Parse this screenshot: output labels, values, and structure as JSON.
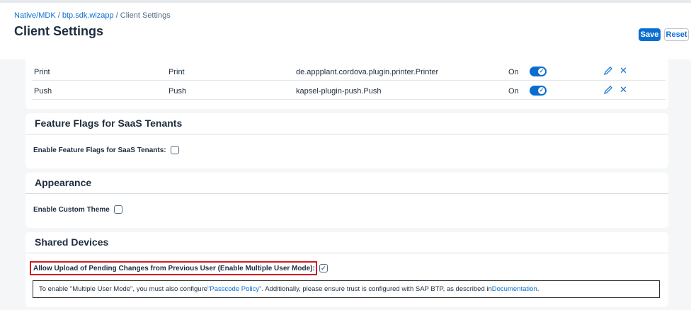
{
  "breadcrumb": {
    "part1": "Native/MDK",
    "sep1": " / ",
    "part2": "btp.sdk.wizapp",
    "sep2": " / ",
    "part3": "Client Settings"
  },
  "page_title": "Client Settings",
  "toolbar": {
    "save_label": "Save",
    "reset_label": "Reset"
  },
  "plugins": [
    {
      "name": "Print",
      "type": "Print",
      "id": "de.appplant.cordova.plugin.printer.Printer",
      "status": "On"
    },
    {
      "name": "Push",
      "type": "Push",
      "id": "kapsel-plugin-push.Push",
      "status": "On"
    }
  ],
  "feature_flags": {
    "title": "Feature Flags for SaaS Tenants",
    "label": "Enable Feature Flags for SaaS Tenants:",
    "checked": false
  },
  "appearance": {
    "title": "Appearance",
    "label": "Enable Custom Theme",
    "checked": false
  },
  "shared_devices": {
    "title": "Shared Devices",
    "label": "Allow Upload of Pending Changes from Previous User (Enable Multiple User Mode):",
    "checked": true,
    "info_pre": "To enable \"Multiple User Mode\", you must also configure ",
    "info_link1": "\"Passcode Policy\"",
    "info_mid": ". Additionally, please ensure trust is configured with SAP BTP, as described in ",
    "info_link2": "Documentation",
    "info_post": "."
  },
  "colors": {
    "accent": "#0a6ed1",
    "highlight": "#d5171f"
  }
}
